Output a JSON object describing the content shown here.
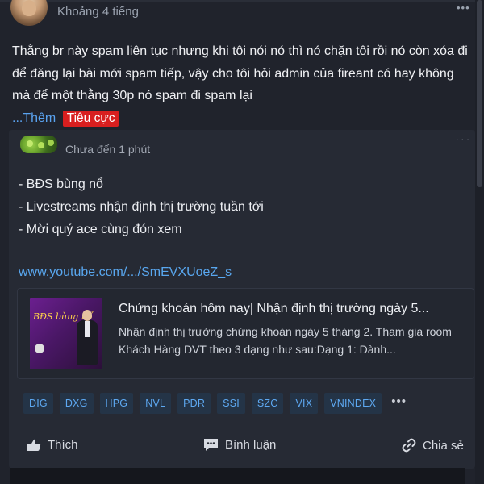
{
  "post": {
    "time": "Khoảng 4 tiếng",
    "text": "Thằng br này spam liên tục nhưng khi tôi nói nó thì nó chặn tôi rồi nó còn xóa đi để đăng lại bài mới spam tiếp, vậy cho tôi hỏi admin của fireant có hay không mà để một thằng 30p nó spam đi spam lại",
    "more_prefix": "...",
    "more_label": "Thêm",
    "sentiment_badge": "Tiêu cực"
  },
  "shared_post": {
    "time": "Chưa đến 1 phút",
    "lines": [
      "- BĐS bùng nổ",
      "- Livestreams nhận định thị trường tuần tới",
      "- Mời quý ace cùng đón xem"
    ],
    "link": "www.youtube.com/.../SmEVXUoeZ_s",
    "preview": {
      "thumb_title": "BĐS bùng nổ",
      "title": "Chứng khoán hôm nay| Nhận định thị trường ngày 5...",
      "description": "Nhận định thị trường chứng khoán ngày 5 tháng 2. Tham gia room Khách Hàng DVT theo 3 dạng như sau:Dạng 1: Dành..."
    },
    "tags": [
      "DIG",
      "DXG",
      "HPG",
      "NVL",
      "PDR",
      "SSI",
      "SZC",
      "VIX",
      "VNINDEX"
    ],
    "tags_more": "•••"
  },
  "actions": {
    "like": "Thích",
    "comment": "Bình luận",
    "share": "Chia sẻ"
  },
  "menu_dots": "•••",
  "colors": {
    "background": "#20232c",
    "link": "#5aa3f0",
    "negative_badge": "#d81f1f",
    "tag_bg": "#243447"
  }
}
